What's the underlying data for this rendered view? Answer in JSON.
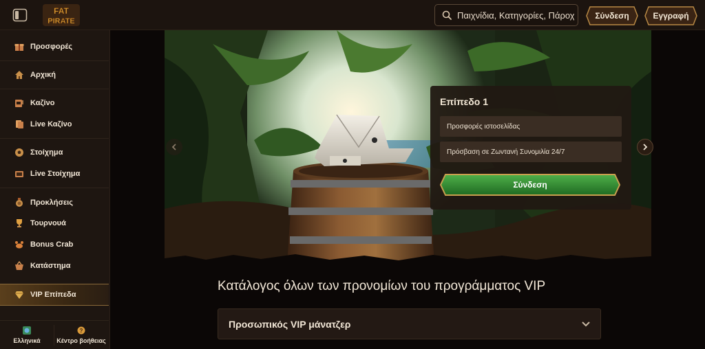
{
  "header": {
    "logo_text_top": "FAT",
    "logo_text_bottom": "PIRATE",
    "search_placeholder": "Παιχνίδια, Κατηγορίες, Πάροχοι",
    "login_label": "Σύνδεση",
    "register_label": "Εγγραφή"
  },
  "sidebar": {
    "items": [
      {
        "label": "Προσφορές",
        "icon": "gift-icon"
      },
      {
        "label": "Αρχική",
        "icon": "home-icon"
      },
      {
        "label": "Καζίνο",
        "icon": "slot-machine-icon"
      },
      {
        "label": "Live Καζίνο",
        "icon": "cards-icon"
      },
      {
        "label": "Στοίχημα",
        "icon": "soccer-ball-icon"
      },
      {
        "label": "Live Στοίχημα",
        "icon": "live-tv-icon"
      },
      {
        "label": "Προκλήσεις",
        "icon": "medal-icon"
      },
      {
        "label": "Τουρνουά",
        "icon": "trophy-icon"
      },
      {
        "label": "Bonus Crab",
        "icon": "crab-icon"
      },
      {
        "label": "Κατάστημα",
        "icon": "basket-icon"
      },
      {
        "label": "VIP Επίπεδα",
        "icon": "diamond-icon"
      }
    ],
    "active_item": "VIP Επίπεδα",
    "bottom": {
      "language_label": "Ελληνικά",
      "help_label": "Κέντρο βοήθειας"
    }
  },
  "main": {
    "level_card": {
      "title": "Επίπεδο 1",
      "benefits": [
        "Προσφορές ιστοσελίδας",
        "Πρόσβαση σε Ζωντανή Συνομιλία 24/7"
      ],
      "login_button": "Σύνδεση"
    },
    "section_title": "Κατάλογος όλων των προνομίων του προγράμματος VIP",
    "accordion": {
      "label": "Προσωπικός VIP μάνατζερ"
    }
  },
  "colors": {
    "background": "#0b0706",
    "panel": "#1e1611",
    "accent_gold": "#c9a04f",
    "button_green": "#2f8a33"
  }
}
